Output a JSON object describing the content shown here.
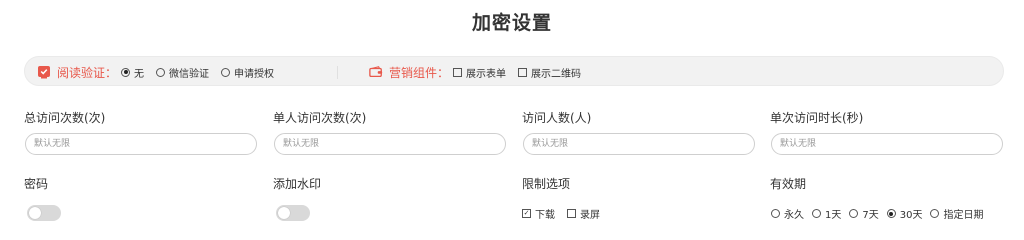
{
  "page": {
    "title": "加密设置"
  },
  "verify": {
    "label": "阅读验证：",
    "options": [
      {
        "label": "无",
        "selected": true
      },
      {
        "label": "微信验证",
        "selected": false
      },
      {
        "label": "申请授权",
        "selected": false
      }
    ]
  },
  "marketing": {
    "label": "营销组件：",
    "options": [
      {
        "label": "展示表单",
        "checked": false
      },
      {
        "label": "展示二维码",
        "checked": false
      }
    ]
  },
  "fields": [
    {
      "label": "总访问次数(次)",
      "placeholder": "默认无限"
    },
    {
      "label": "单人访问次数(次)",
      "placeholder": "默认无限"
    },
    {
      "label": "访问人数(人)",
      "placeholder": "默认无限"
    },
    {
      "label": "单次访问时长(秒)",
      "placeholder": "默认无限"
    }
  ],
  "password": {
    "label": "密码",
    "enabled": false
  },
  "watermark": {
    "label": "添加水印",
    "enabled": false
  },
  "restrict": {
    "label": "限制选项",
    "options": [
      {
        "label": "下载",
        "checked": true
      },
      {
        "label": "录屏",
        "checked": false
      }
    ]
  },
  "validity": {
    "label": "有效期",
    "options": [
      {
        "label": "永久",
        "selected": false
      },
      {
        "label": "1天",
        "selected": false
      },
      {
        "label": "7天",
        "selected": false
      },
      {
        "label": "30天",
        "selected": true
      },
      {
        "label": "指定日期",
        "selected": false
      }
    ]
  },
  "colors": {
    "accent": "#e8584b",
    "bar_bg": "#f2f2f2",
    "toggle_off": "#d9d9d9"
  }
}
